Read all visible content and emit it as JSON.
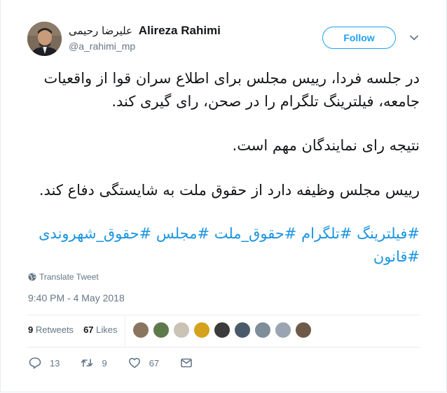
{
  "author": {
    "name": "Alireza Rahimi",
    "name_fa": "علیرضا رحیمی",
    "handle": "@a_rahimi_mp"
  },
  "follow_label": "Follow",
  "tweet": {
    "line1": "در جلسه فردا، رییس مجلس برای اطلاع سران قوا از واقعیات جامعه، فیلترینگ تلگرام را در صحن، رای گیری کند.",
    "line2": "نتیجه رای نمایندگان مهم است.",
    "line3": "رییس مجلس وظیفه دارد از حقوق ملت به شایستگی دفاع کند.",
    "hashtags": "#فیلترینگ #تلگرام #حقوق_ملت  #مجلس #حقوق_شهروندی #قانون"
  },
  "translate_label": "Translate Tweet",
  "timestamp": "9:40 PM - 4 May 2018",
  "stats": {
    "retweets_count": "9",
    "retweets_label": "Retweets",
    "likes_count": "67",
    "likes_label": "Likes"
  },
  "actions": {
    "reply_count": "13",
    "retweet_count": "9",
    "like_count": "67"
  },
  "colors": {
    "accent": "#1da1f2",
    "link": "#1b95e0",
    "muted": "#657786"
  }
}
